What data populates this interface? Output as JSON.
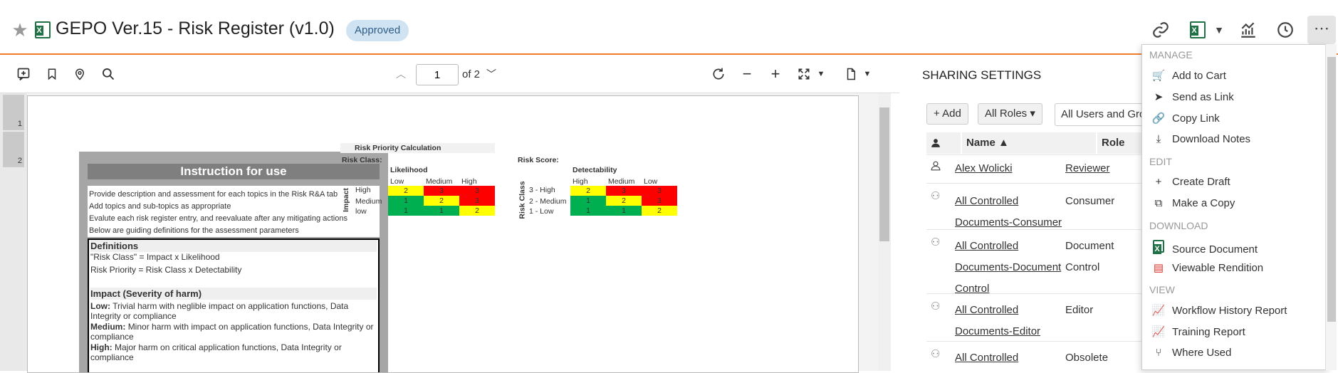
{
  "header": {
    "title": "GEPO Ver.15 - Risk Register (v1.0)",
    "badge": "Approved"
  },
  "viewer": {
    "page_value": "1",
    "page_of": "of 2",
    "thumbnails": [
      "1",
      "2"
    ]
  },
  "document": {
    "instruction_title": "Instruction for use",
    "instructions": [
      "Provide description and assessment for each topics in the Risk R&A tab",
      "Add topics and sub-topics as appropriate",
      "Evalute each risk register entry, and reevaluate after any mitigating actions",
      "Below are guiding definitions for the assessment parameters"
    ],
    "definitions_head": "Definitions",
    "def_risk_class": "\"Risk Class\" = Impact x Likelihood",
    "def_risk_priority": "Risk Priority = Risk Class x Detectability",
    "impact_head": "Impact (Severity of harm)",
    "impact_low_label": "Low:",
    "impact_low_text": "Trivial harm with neglible impact on application functions, Data Integrity or compliance",
    "impact_medium_label": "Medium:",
    "impact_medium_text": "Minor harm with impact on application functions, Data Integrity or compliance",
    "impact_high_label": "High:",
    "impact_high_text": "Major harm on critical application functions, Data Integrity or compliance",
    "risk_priority_title": "Risk Priority Calculation",
    "risk_class_title": "Risk Class:",
    "likelihood": "Likelihood",
    "impact_axis": "Impact",
    "rc_cols": [
      "Low",
      "Medium",
      "High"
    ],
    "rc_rows": [
      "High",
      "Medium",
      "low"
    ],
    "rc_values": [
      [
        "2",
        "3",
        "3"
      ],
      [
        "1",
        "2",
        "3"
      ],
      [
        "1",
        "1",
        "2"
      ]
    ],
    "risk_score_title": "Risk Score:",
    "detectability": "Detectability",
    "risk_class_axis": "Risk Class",
    "rs_cols": [
      "High",
      "Medium",
      "Low"
    ],
    "rs_rows": [
      "3 - High",
      "2 - Medium",
      "1 - Low"
    ],
    "rs_values": [
      [
        "2",
        "3",
        "3"
      ],
      [
        "1",
        "2",
        "3"
      ],
      [
        "1",
        "1",
        "2"
      ]
    ]
  },
  "sharing": {
    "title": "SHARING SETTINGS",
    "add_label": "Add",
    "roles_label": "All Roles",
    "users_filter": "All Users and Groups",
    "col_name": "Name",
    "col_role": "Role",
    "rows": [
      {
        "name": "Alex Wolicki",
        "role": "Reviewer"
      },
      {
        "name1": "All Controlled",
        "name2": "Documents-Consumer",
        "role": "Consumer"
      },
      {
        "name1": "All Controlled",
        "name2": "Documents-Document",
        "name3": "Control",
        "role1": "Document",
        "role2": "Control"
      },
      {
        "name1": "All Controlled",
        "name2": "Documents-Editor",
        "role": "Editor"
      },
      {
        "name1": "All Controlled",
        "role": "Obsolete"
      }
    ]
  },
  "menu": {
    "manage_label": "MANAGE",
    "add_to_cart": "Add to Cart",
    "send_as_link": "Send as Link",
    "copy_link": "Copy Link",
    "download_notes": "Download Notes",
    "edit_label": "EDIT",
    "create_draft": "Create Draft",
    "make_copy": "Make a Copy",
    "download_label": "DOWNLOAD",
    "source_document": "Source Document",
    "viewable_rendition": "Viewable Rendition",
    "view_label": "VIEW",
    "workflow_history": "Workflow History Report",
    "training_report": "Training Report",
    "where_used": "Where Used"
  }
}
